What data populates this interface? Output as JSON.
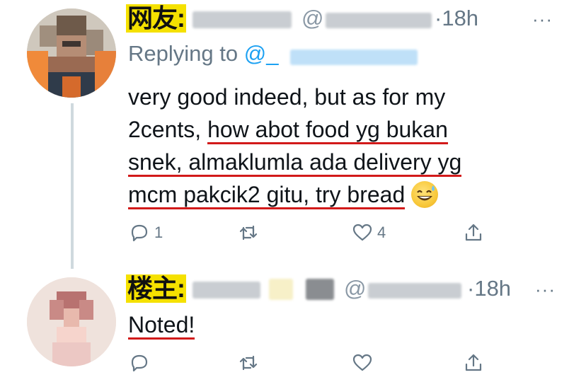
{
  "tweet1": {
    "tag": "网友:",
    "handle_at": "@",
    "time": "·18h",
    "more": "···",
    "replying_prefix": "Replying to",
    "replying_at": "@_",
    "body_line1": "very good indeed, but as for my",
    "body_line2_plain": "2cents, ",
    "body_line2_ul": "how abot food yg bukan",
    "body_line3_ul": "snek, almaklumla ada delivery yg",
    "body_line4_ul": "mcm pakcik2 gitu, try bread",
    "emoji": "sweat-smile-emoji",
    "reply_count": "1",
    "like_count": "4"
  },
  "tweet2": {
    "tag": "楼主:",
    "handle_at": "@",
    "time": "·18h",
    "more": "···",
    "body": "Noted!"
  },
  "colors": {
    "accent": "#1da1f2",
    "gray": "#657786",
    "underline": "#d21a1a",
    "tag_bg": "#f5e100",
    "thread_line": "#cfd9de"
  }
}
